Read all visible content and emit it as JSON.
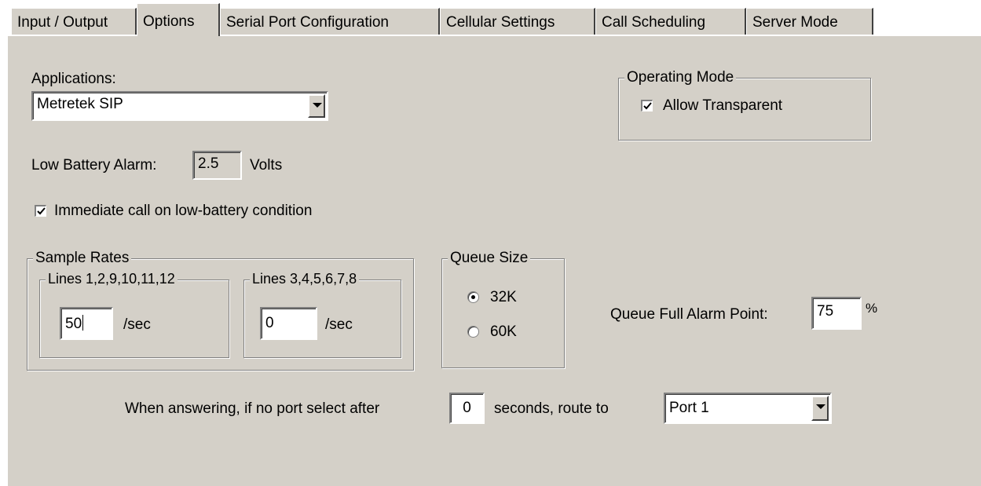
{
  "tabs": [
    {
      "label": "Input / Output"
    },
    {
      "label": "Options",
      "active": true
    },
    {
      "label": "Serial Port Configuration"
    },
    {
      "label": "Cellular Settings"
    },
    {
      "label": "Call Scheduling"
    },
    {
      "label": "Server Mode"
    }
  ],
  "applications": {
    "label": "Applications:",
    "selected": "Metretek SIP"
  },
  "operating_mode": {
    "title": "Operating Mode",
    "allow_transparent": {
      "label": "Allow Transparent",
      "checked": true
    }
  },
  "low_battery": {
    "label": "Low Battery Alarm:",
    "value": "2.5",
    "unit": "Volts"
  },
  "immediate_call": {
    "label": "Immediate call on low-battery condition",
    "checked": true
  },
  "sample_rates": {
    "title": "Sample Rates",
    "group1": {
      "title": "Lines 1,2,9,10,11,12",
      "value": "50",
      "unit": "/sec"
    },
    "group2": {
      "title": "Lines 3,4,5,6,7,8",
      "value": "0",
      "unit": "/sec"
    }
  },
  "queue_size": {
    "title": "Queue Size",
    "options": [
      {
        "label": "32K",
        "selected": true
      },
      {
        "label": "60K",
        "selected": false
      }
    ]
  },
  "queue_full": {
    "label": "Queue Full Alarm Point:",
    "value": "75",
    "unit": "%"
  },
  "answering": {
    "prefix": "When answering, if no port select after",
    "seconds": "0",
    "suffix": "seconds, route to",
    "route": "Port 1"
  },
  "colors": {
    "panel": "#d4d0c8",
    "shadow": "#808080",
    "highlight": "#ffffff"
  }
}
